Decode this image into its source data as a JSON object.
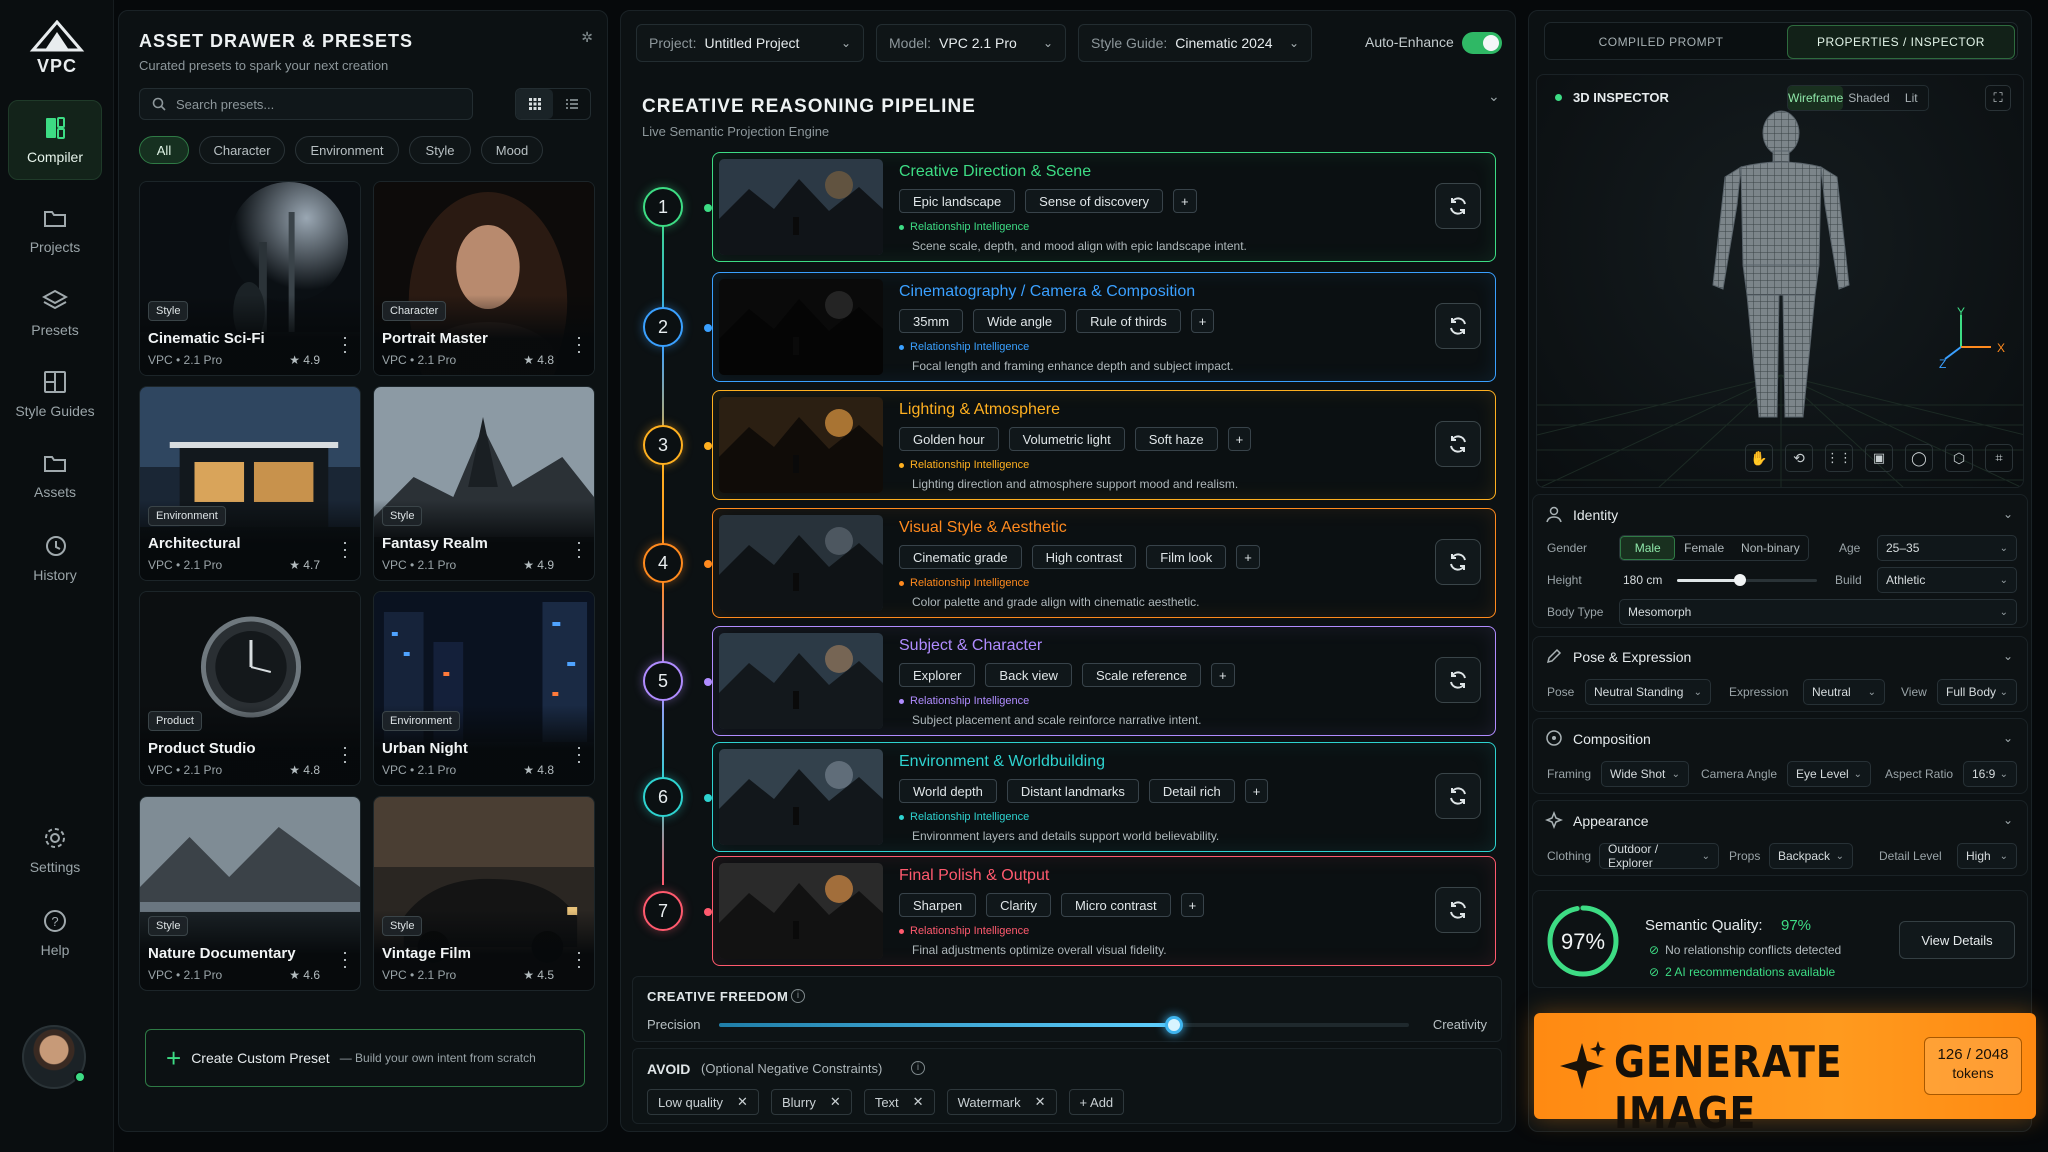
{
  "app": {
    "logo_text": "VPC"
  },
  "rail": {
    "items": [
      {
        "label": "Compiler",
        "icon": "compiler-icon"
      },
      {
        "label": "Projects",
        "icon": "folder-icon"
      },
      {
        "label": "Presets",
        "icon": "layers-icon"
      },
      {
        "label": "Style Guides",
        "icon": "book-icon"
      },
      {
        "label": "Assets",
        "icon": "folder-icon"
      },
      {
        "label": "History",
        "icon": "history-icon"
      },
      {
        "label": "Settings",
        "icon": "gear-icon"
      },
      {
        "label": "Help",
        "icon": "help-icon"
      }
    ]
  },
  "drawer": {
    "title": "ASSET DRAWER & PRESETS",
    "subtitle": "Curated presets to spark your next creation",
    "search_placeholder": "Search presets...",
    "filters": [
      "All",
      "Character",
      "Environment",
      "Style",
      "Mood"
    ],
    "active_filter": "All",
    "cards": [
      {
        "badge": "Style",
        "title": "Cinematic Sci-Fi",
        "meta": "VPC • 2.1 Pro",
        "rating": "★ 4.9"
      },
      {
        "badge": "Character",
        "title": "Portrait Master",
        "meta": "VPC • 2.1 Pro",
        "rating": "★ 4.8"
      },
      {
        "badge": "Environment",
        "title": "Architectural",
        "meta": "VPC • 2.1 Pro",
        "rating": "★ 4.7"
      },
      {
        "badge": "Style",
        "title": "Fantasy Realm",
        "meta": "VPC • 2.1 Pro",
        "rating": "★ 4.9"
      },
      {
        "badge": "Product",
        "title": "Product Studio",
        "meta": "VPC • 2.1 Pro",
        "rating": "★ 4.8"
      },
      {
        "badge": "Environment",
        "title": "Urban Night",
        "meta": "VPC • 2.1 Pro",
        "rating": "★ 4.8"
      },
      {
        "badge": "Style",
        "title": "Nature Documentary",
        "meta": "VPC • 2.1 Pro",
        "rating": "★ 4.6"
      },
      {
        "badge": "Style",
        "title": "Vintage Film",
        "meta": "VPC • 2.1 Pro",
        "rating": "★ 4.5"
      }
    ],
    "create_label": "Create Custom Preset",
    "create_sub": "— Build your own intent from scratch"
  },
  "toolbar": {
    "project_key": "Project:",
    "project_val": "Untitled Project",
    "model_key": "Model:",
    "model_val": "VPC 2.1 Pro",
    "style_key": "Style Guide:",
    "style_val": "Cinematic 2024",
    "auto_enhance": "Auto-Enhance"
  },
  "pipeline": {
    "title": "CREATIVE REASONING PIPELINE",
    "subtitle": "Live Semantic Projection Engine",
    "ri_label": "Relationship Intelligence",
    "stages": [
      {
        "num": "1",
        "title": "Creative Direction & Scene",
        "chips": [
          "Epic landscape",
          "Sense of discovery"
        ],
        "desc": "Scene scale, depth, and mood align with epic landscape intent.",
        "color": "#3ddc84"
      },
      {
        "num": "2",
        "title": "Cinematography / Camera & Composition",
        "chips": [
          "35mm",
          "Wide angle",
          "Rule of thirds"
        ],
        "desc": "Focal length and framing enhance depth and subject impact.",
        "color": "#3aa0ff"
      },
      {
        "num": "3",
        "title": "Lighting & Atmosphere",
        "chips": [
          "Golden hour",
          "Volumetric light",
          "Soft haze"
        ],
        "desc": "Lighting direction and atmosphere support mood and realism.",
        "color": "#ffb020"
      },
      {
        "num": "4",
        "title": "Visual Style & Aesthetic",
        "chips": [
          "Cinematic grade",
          "High contrast",
          "Film look"
        ],
        "desc": "Color palette and grade align with cinematic aesthetic.",
        "color": "#ff8a1e"
      },
      {
        "num": "5",
        "title": "Subject & Character",
        "chips": [
          "Explorer",
          "Back view",
          "Scale reference"
        ],
        "desc": "Subject placement and scale reinforce narrative intent.",
        "color": "#b08cff"
      },
      {
        "num": "6",
        "title": "Environment & Worldbuilding",
        "chips": [
          "World depth",
          "Distant landmarks",
          "Detail rich"
        ],
        "desc": "Environment layers and details support world believability.",
        "color": "#2ed3d0"
      },
      {
        "num": "7",
        "title": "Final Polish & Output",
        "chips": [
          "Sharpen",
          "Clarity",
          "Micro contrast"
        ],
        "desc": "Final adjustments optimize overall visual fidelity.",
        "color": "#ff5a6e"
      }
    ],
    "freedom_title": "CREATIVE FREEDOM",
    "freedom_left": "Precision",
    "freedom_right": "Creativity",
    "freedom_value": 0.66,
    "avoid_title": "AVOID",
    "avoid_sub": "(Optional Negative Constraints)",
    "avoid_chips": [
      "Low quality",
      "Blurry",
      "Text",
      "Watermark"
    ],
    "avoid_add": "+ Add"
  },
  "right": {
    "tabs": [
      "COMPILED PROMPT",
      "PROPERTIES / INSPECTOR"
    ],
    "active_tab": "PROPERTIES / INSPECTOR",
    "inspector_title": "3D INSPECTOR",
    "view_modes": [
      "Wireframe",
      "Shaded",
      "Lit"
    ],
    "active_view": "Wireframe",
    "axes": {
      "x": "X",
      "y": "Y",
      "z": "Z"
    },
    "identity": {
      "title": "Identity",
      "gender_label": "Gender",
      "genders": [
        "Male",
        "Female",
        "Non-binary"
      ],
      "gender": "Male",
      "age_label": "Age",
      "age": "25–35",
      "height_label": "Height",
      "height": "180 cm",
      "height_fraction": 0.45,
      "build_label": "Build",
      "build": "Athletic",
      "body_label": "Body Type",
      "body": "Mesomorph"
    },
    "pose": {
      "title": "Pose & Expression",
      "pose_label": "Pose",
      "pose": "Neutral Standing",
      "expr_label": "Expression",
      "expr": "Neutral",
      "view_label": "View",
      "view": "Full Body"
    },
    "composition": {
      "title": "Composition",
      "framing_label": "Framing",
      "framing": "Wide Shot",
      "angle_label": "Camera Angle",
      "angle": "Eye Level",
      "aspect_label": "Aspect Ratio",
      "aspect": "16:9"
    },
    "appearance": {
      "title": "Appearance",
      "clothing_label": "Clothing",
      "clothing": "Outdoor / Explorer",
      "props_label": "Props",
      "props": "Backpack",
      "detail_label": "Detail Level",
      "detail": "High"
    },
    "quality": {
      "percent": "97%",
      "value": 0.97,
      "title": "Semantic Quality:",
      "title_val": "97%",
      "line1": "No relationship conflicts detected",
      "line2": "2 AI recommendations available",
      "button": "View Details"
    },
    "generate": {
      "label": "GENERATE IMAGE",
      "tokens": "126 / 2048",
      "tokens_unit": "tokens"
    }
  }
}
